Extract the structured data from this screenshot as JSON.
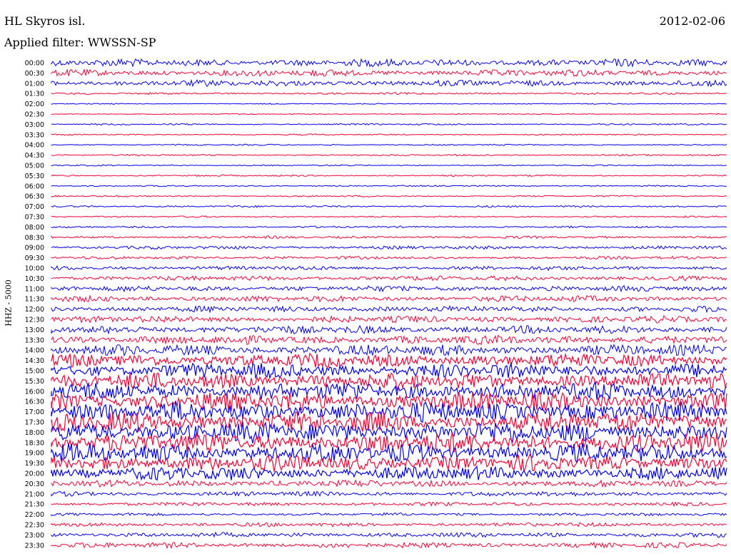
{
  "header": {
    "station": "HL Skyros isl.",
    "date": "2012-02-06",
    "filter": "Applied filter: WWSSN-SP",
    "channel": "HHZ - 5000"
  },
  "colors": {
    "trace_a": "#0000ff",
    "trace_b": "#ff0033",
    "background": "#ffffff",
    "text": "#000000"
  },
  "time_labels": [
    "00:00",
    "00:30",
    "01:00",
    "01:30",
    "02:00",
    "02:30",
    "03:00",
    "03:30",
    "04:00",
    "04:30",
    "05:00",
    "05:30",
    "06:00",
    "06:30",
    "07:00",
    "07:30",
    "08:00",
    "08:30",
    "09:00",
    "09:30",
    "10:00",
    "10:30",
    "11:00",
    "11:30",
    "12:00",
    "12:30",
    "13:00",
    "13:30",
    "14:00",
    "14:30",
    "15:00",
    "15:30",
    "16:00",
    "16:30",
    "17:00",
    "17:30",
    "18:00",
    "18:30",
    "19:00",
    "19:30",
    "20:00",
    "20:30",
    "21:00",
    "21:30",
    "22:00",
    "22:30",
    "23:00",
    "23:30"
  ],
  "trace_activity": [
    0.55,
    0.5,
    0.45,
    0.15,
    0.08,
    0.08,
    0.12,
    0.1,
    0.1,
    0.12,
    0.1,
    0.12,
    0.1,
    0.12,
    0.14,
    0.12,
    0.14,
    0.18,
    0.25,
    0.22,
    0.3,
    0.35,
    0.4,
    0.45,
    0.45,
    0.5,
    0.6,
    0.65,
    0.8,
    1.0,
    1.1,
    1.2,
    1.3,
    1.4,
    1.45,
    1.5,
    1.5,
    1.45,
    1.4,
    1.2,
    1.0,
    0.5,
    0.35,
    0.28,
    0.22,
    0.3,
    0.35,
    0.4
  ]
}
